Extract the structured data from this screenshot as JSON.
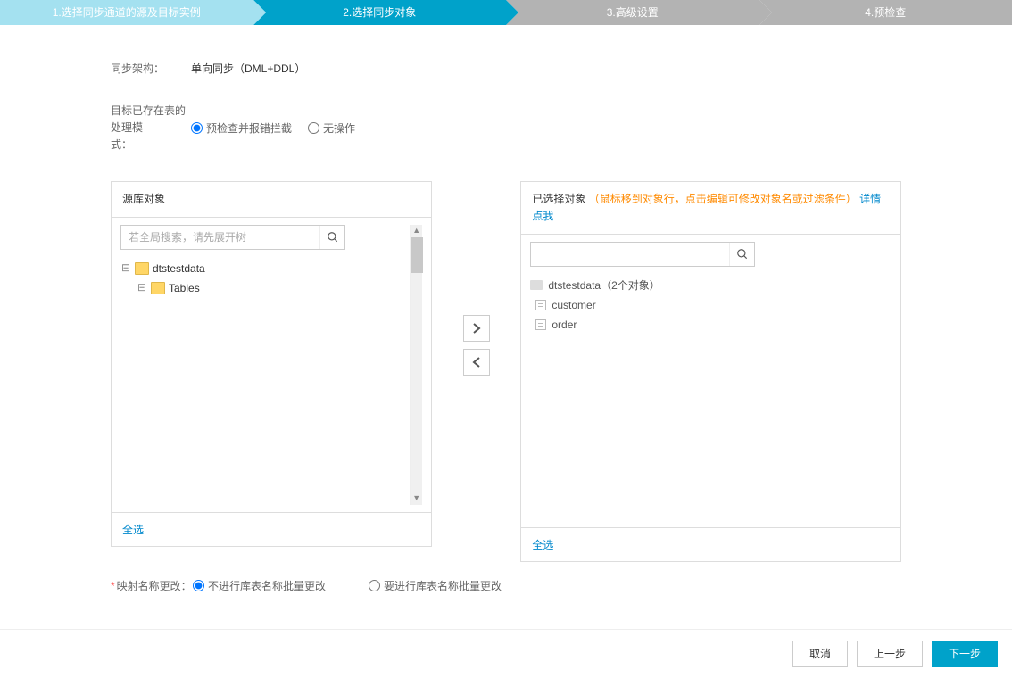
{
  "steps": [
    {
      "label": "1.选择同步通道的源及目标实例"
    },
    {
      "label": "2.选择同步对象"
    },
    {
      "label": "3.高级设置"
    },
    {
      "label": "4.预检查"
    }
  ],
  "sync_arch": {
    "label": "同步架构：",
    "value": "单向同步（DML+DDL）"
  },
  "existing_mode": {
    "label1": "目标已存在表的处理模",
    "label2": "式：",
    "option1": "预检查并报错拦截",
    "option2": "无操作"
  },
  "left_panel": {
    "title": "源库对象",
    "search_placeholder": "若全局搜索，请先展开树",
    "tree": {
      "root": "dtstestdata",
      "child": "Tables"
    },
    "select_all": "全选"
  },
  "right_panel": {
    "title": "已选择对象",
    "hint": "（鼠标移到对象行，点击编辑可修改对象名或过滤条件）",
    "link": "详情点我",
    "selected": {
      "db": "dtstestdata（2个对象）",
      "t1": "customer",
      "t2": "order"
    },
    "select_all": "全选"
  },
  "mapping": {
    "label": "映射名称更改：",
    "opt1": "不进行库表名称批量更改",
    "opt2": "要进行库表名称批量更改"
  },
  "footer": {
    "cancel": "取消",
    "prev": "上一步",
    "next": "下一步"
  }
}
